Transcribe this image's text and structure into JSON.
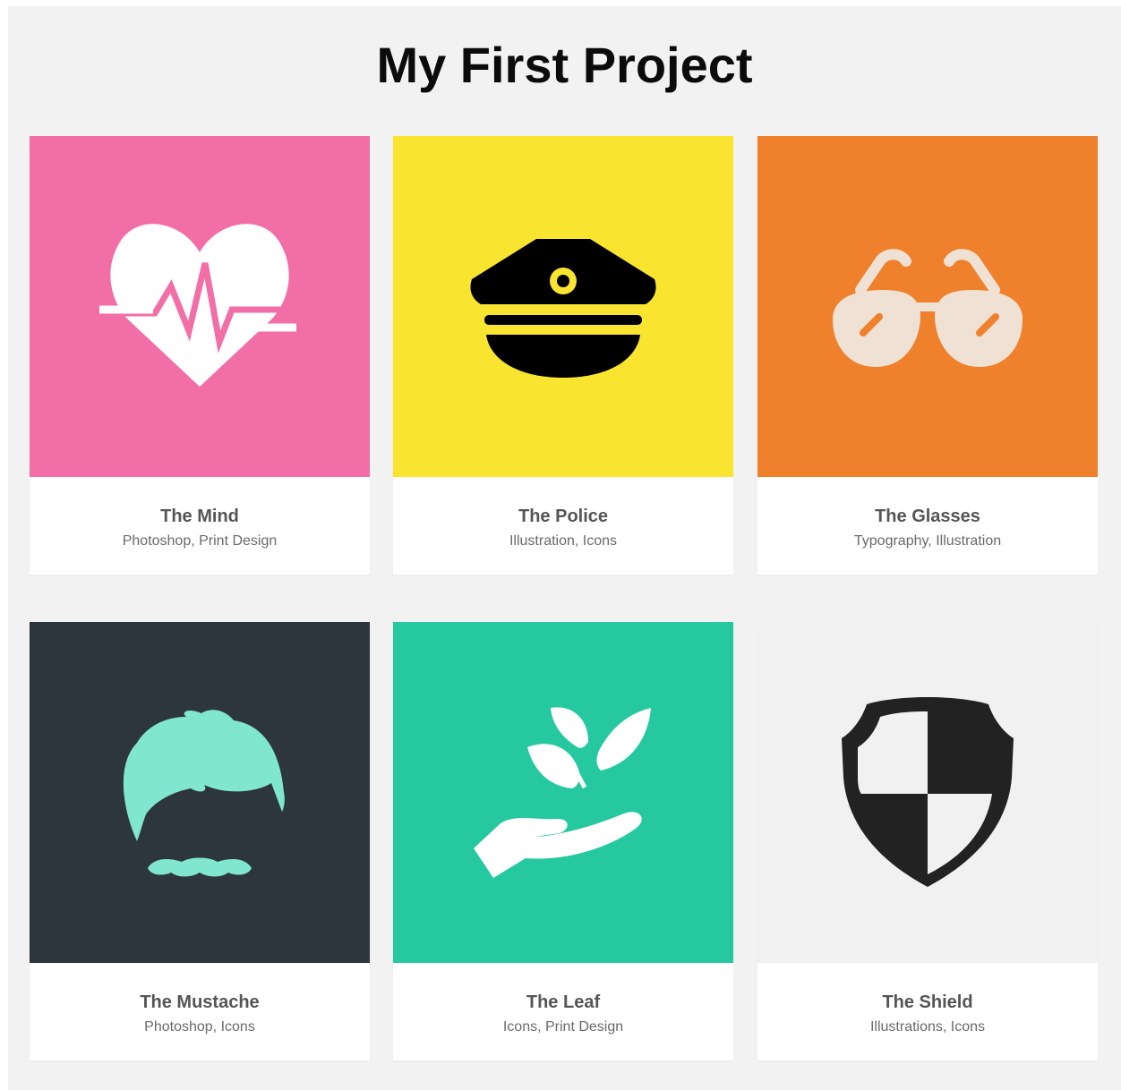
{
  "page": {
    "title": "My First Project"
  },
  "projects": [
    {
      "name": "The Mind",
      "tags": "Photoshop, Print Design",
      "icon": "heartbeat-icon",
      "bg": "#f26ea7",
      "fg": "#ffffff"
    },
    {
      "name": "The Police",
      "tags": "Illustration, Icons",
      "icon": "police-cap-icon",
      "bg": "#f9e42f",
      "fg": "#000000"
    },
    {
      "name": "The Glasses",
      "tags": "Typography, Illustration",
      "icon": "sunglasses-icon",
      "bg": "#ef812d",
      "fg": "#efe1d3"
    },
    {
      "name": "The Mustache",
      "tags": "Photoshop, Icons",
      "icon": "hair-mustache-icon",
      "bg": "#2d353d",
      "fg": "#80e6d0"
    },
    {
      "name": "The Leaf",
      "tags": "Icons, Print Design",
      "icon": "hand-leaf-icon",
      "bg": "#25c89f",
      "fg": "#ffffff"
    },
    {
      "name": "The Shield",
      "tags": "Illustrations, Icons",
      "icon": "shield-icon",
      "bg": "#f1f1f1",
      "fg": "#222222"
    }
  ]
}
